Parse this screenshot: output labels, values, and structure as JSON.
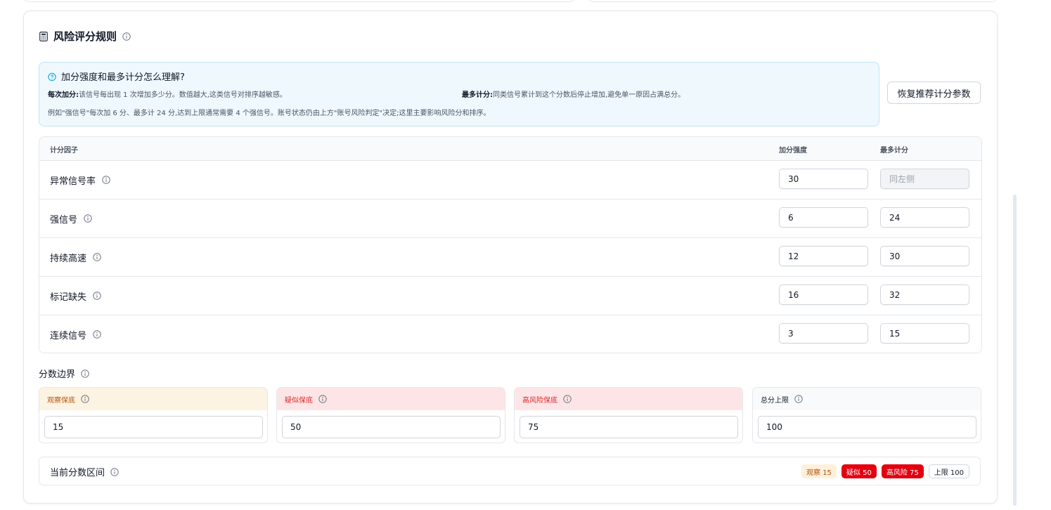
{
  "title": "风险评分规则",
  "help": {
    "question": "加分强度和最多计分怎么理解?",
    "each_label": "每次加分:",
    "each_text": "该信号每出现 1 次增加多少分。数值越大,这类信号对排序越敏感。",
    "max_label": "最多计分:",
    "max_text": "同类信号累计到这个分数后停止增加,避免单一原因占满总分。",
    "example": "例如\"强信号\"每次加 6 分、最多计 24 分,达到上限通常需要 4 个强信号。账号状态仍由上方\"账号风险判定\"决定;这里主要影响风险分和排序。"
  },
  "reset_button": "恢复推荐计分参数",
  "table": {
    "col_factor": "计分因子",
    "col_strength": "加分强度",
    "col_max": "最多计分",
    "rows": [
      {
        "label": "异常信号率",
        "strength": "30",
        "max": "",
        "max_placeholder": "同左侧"
      },
      {
        "label": "强信号",
        "strength": "6",
        "max": "24"
      },
      {
        "label": "持续高速",
        "strength": "12",
        "max": "30"
      },
      {
        "label": "标记缺失",
        "strength": "16",
        "max": "32"
      },
      {
        "label": "连续信号",
        "strength": "3",
        "max": "15"
      }
    ]
  },
  "bounds": {
    "title": "分数边界",
    "items": [
      {
        "label": "观察保底",
        "value": "15"
      },
      {
        "label": "疑似保底",
        "value": "50"
      },
      {
        "label": "高风险保底",
        "value": "75"
      },
      {
        "label": "总分上限",
        "value": "100"
      }
    ]
  },
  "range": {
    "label": "当前分数区间",
    "badges": [
      "观察 15",
      "疑似 50",
      "高风险 75",
      "上限 100"
    ]
  },
  "colors": {
    "watch": "#b45309",
    "danger": "#e3000f",
    "help_bg": "#eff8fd",
    "info": "#0ea5e9"
  }
}
